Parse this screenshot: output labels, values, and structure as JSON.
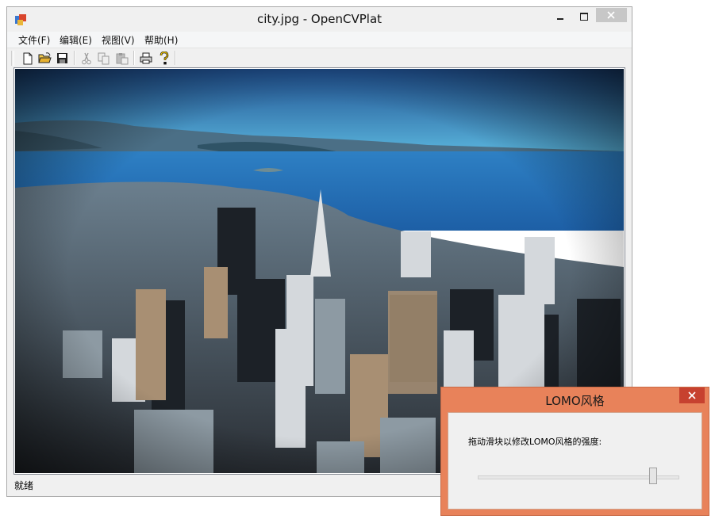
{
  "window": {
    "title": "city.jpg - OpenCVPlat"
  },
  "menu": {
    "items": [
      {
        "label": "文件(F)"
      },
      {
        "label": "编辑(E)"
      },
      {
        "label": "视图(V)"
      },
      {
        "label": "帮助(H)"
      }
    ]
  },
  "toolbar": {
    "buttons": [
      {
        "icon": "new-file-icon",
        "enabled": true
      },
      {
        "icon": "open-folder-icon",
        "enabled": true
      },
      {
        "icon": "save-icon",
        "enabled": true
      },
      {
        "icon": "cut-icon",
        "enabled": false
      },
      {
        "icon": "copy-icon",
        "enabled": false
      },
      {
        "icon": "paste-icon",
        "enabled": false
      },
      {
        "icon": "print-icon",
        "enabled": true
      },
      {
        "icon": "help-icon",
        "enabled": true
      }
    ]
  },
  "statusbar": {
    "text": "就绪"
  },
  "dialog": {
    "title": "LOMO风格",
    "prompt": "拖动滑块以修改LOMO风格的强度:",
    "slider_value_fraction": 0.87
  },
  "colors": {
    "dialog_frame": "#e8825a",
    "dialog_close": "#c7412f",
    "window_bg": "#f0f0f0"
  }
}
